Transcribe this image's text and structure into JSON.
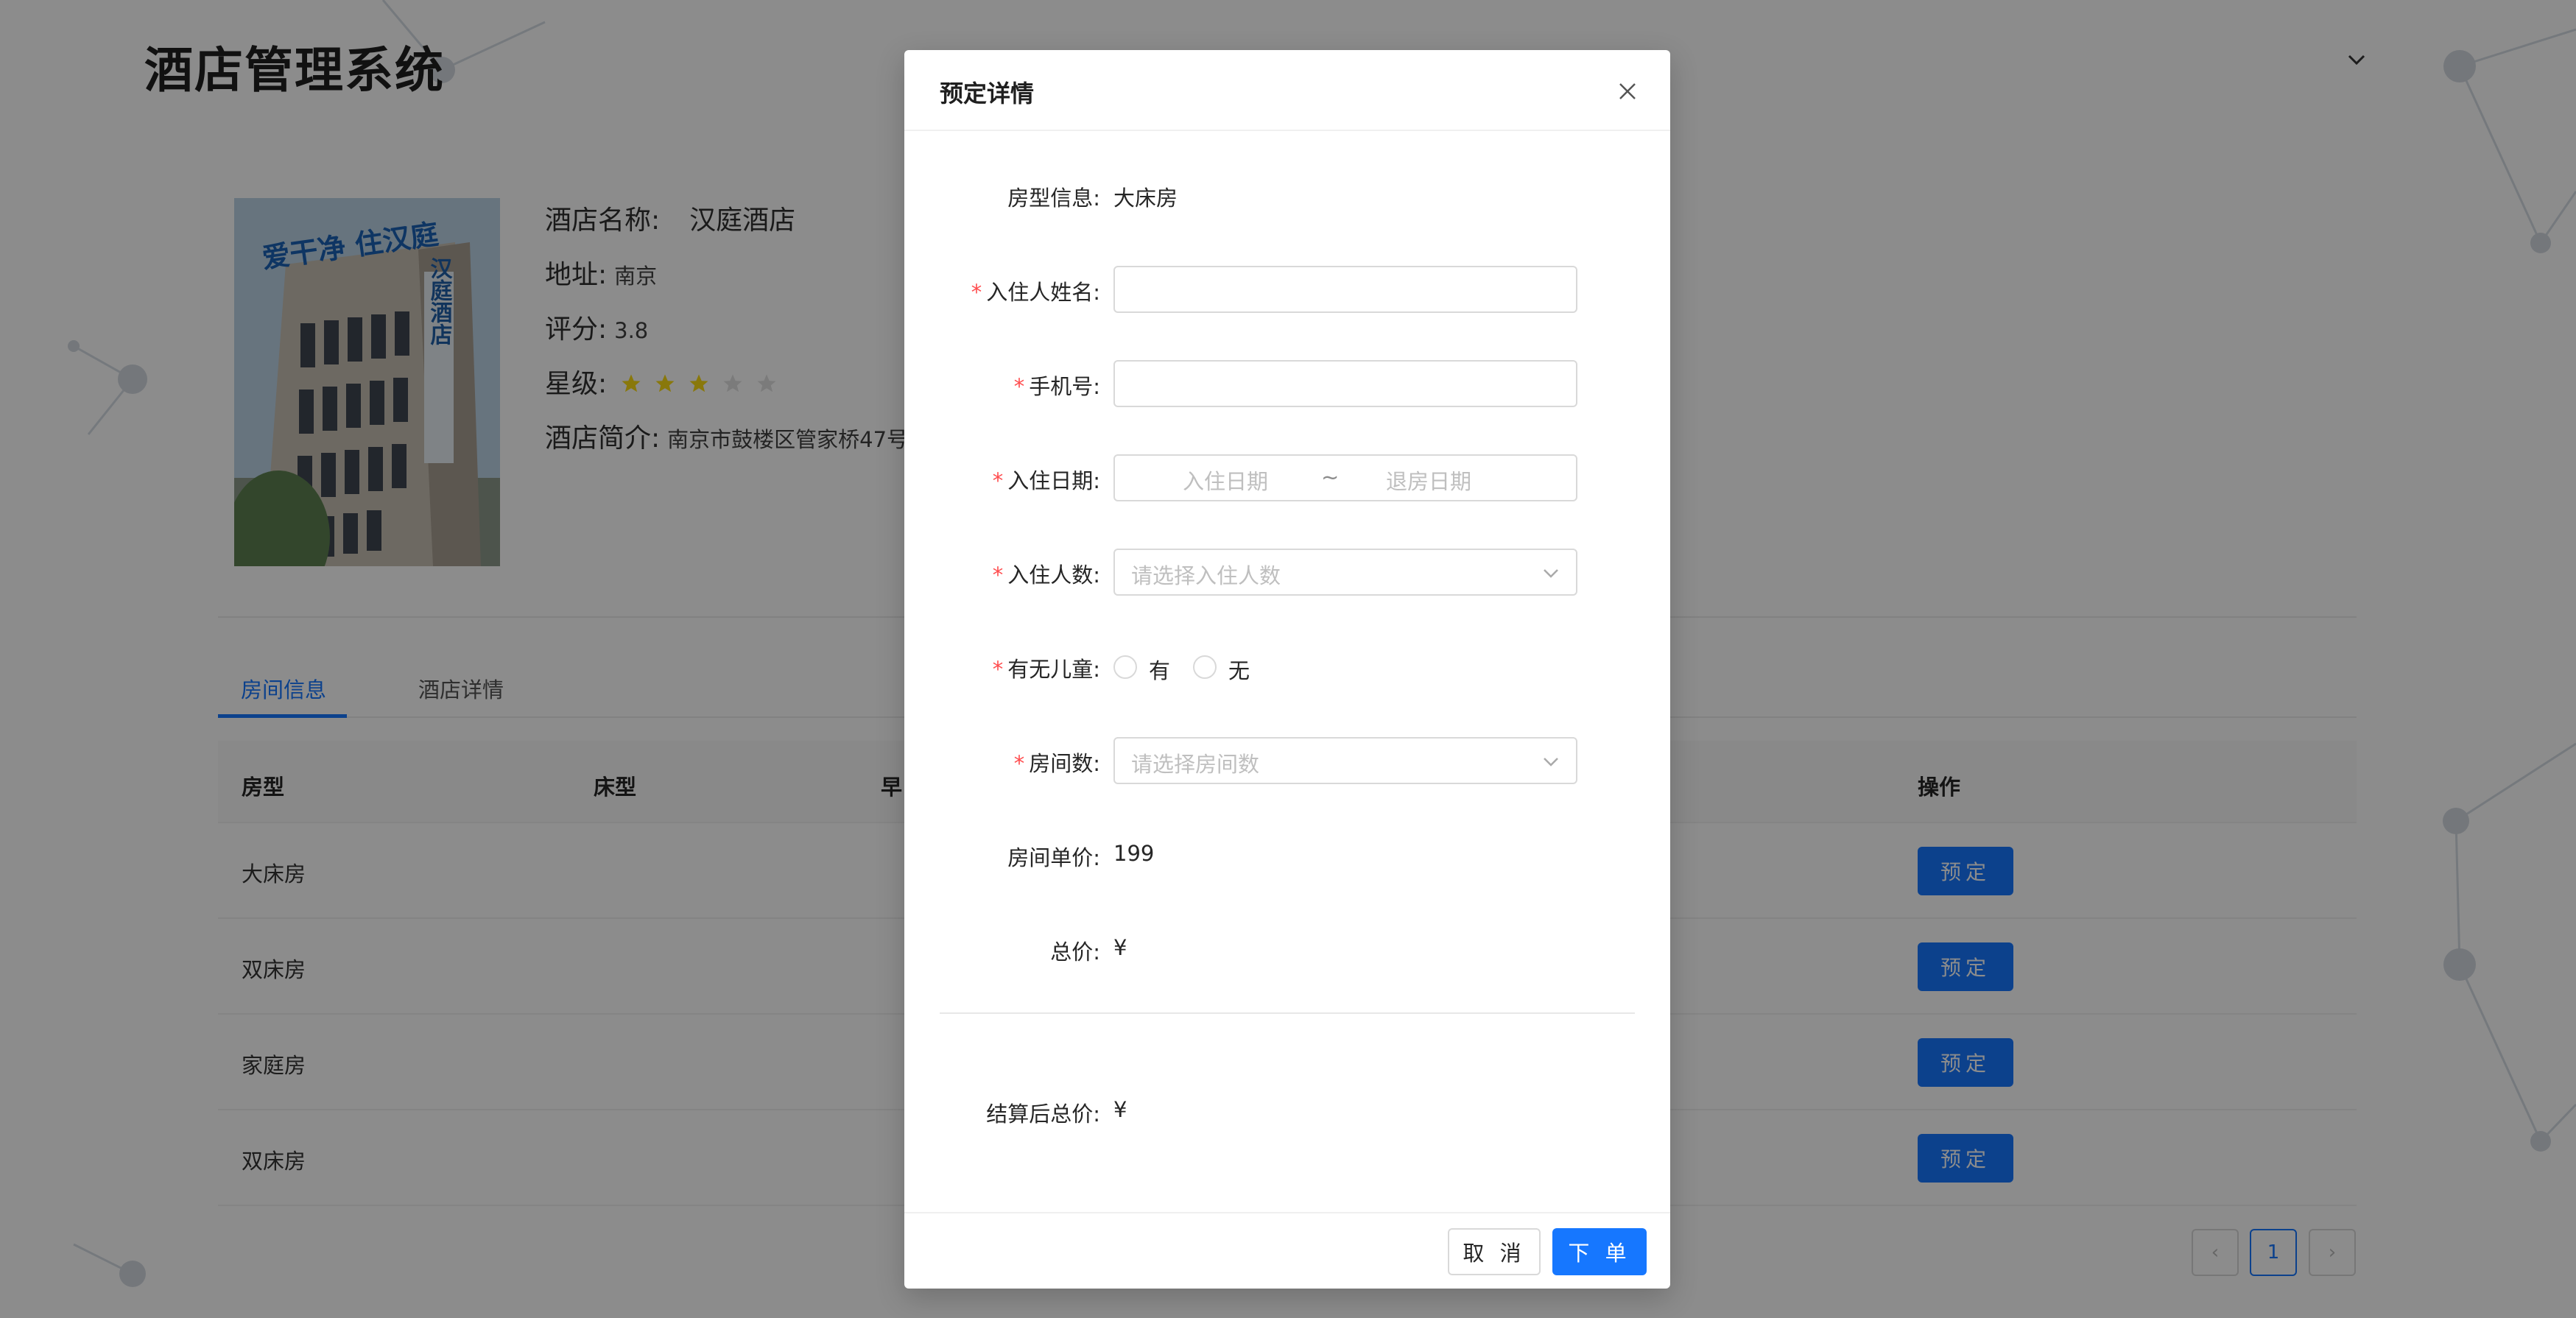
{
  "app": {
    "title": "酒店管理系统"
  },
  "hotel": {
    "name_label": "酒店名称:",
    "name": "汉庭酒店",
    "address_label": "地址:",
    "address": "南京",
    "rating_label": "评分:",
    "rating": "3.8",
    "stars_label": "星级:",
    "stars": 3,
    "stars_max": 5,
    "intro_label": "酒店简介:",
    "intro": "南京市鼓楼区管家桥47号",
    "photo_sign_top": "爱干净 住汉庭",
    "photo_sign_side": "汉庭酒店"
  },
  "tabs": [
    {
      "label": "房间信息",
      "active": true
    },
    {
      "label": "酒店详情",
      "active": false
    }
  ],
  "table": {
    "headers": [
      "房型",
      "床型",
      "早",
      "操作"
    ],
    "rows": [
      {
        "type": "大床房",
        "action": "预定"
      },
      {
        "type": "双床房",
        "action": "预定"
      },
      {
        "type": "家庭房",
        "action": "预定"
      },
      {
        "type": "双床房",
        "action": "预定"
      }
    ]
  },
  "pagination": {
    "prev": "‹",
    "current": "1",
    "next": "›"
  },
  "modal": {
    "title": "预定详情",
    "fields": {
      "room_type": {
        "label": "房型信息:",
        "value": "大床房"
      },
      "guest_name": {
        "label": "入住人姓名:",
        "required": true,
        "value": ""
      },
      "phone": {
        "label": "手机号:",
        "required": true,
        "value": ""
      },
      "dates": {
        "label": "入住日期:",
        "required": true,
        "start_placeholder": "入住日期",
        "separator": "~",
        "end_placeholder": "退房日期"
      },
      "guests": {
        "label": "入住人数:",
        "required": true,
        "placeholder": "请选择入住人数"
      },
      "children": {
        "label": "有无儿童:",
        "required": true,
        "options": [
          "有",
          "无"
        ]
      },
      "rooms": {
        "label": "房间数:",
        "required": true,
        "placeholder": "请选择房间数"
      },
      "unit_price": {
        "label": "房间单价:",
        "value": "199"
      },
      "total": {
        "label": "总价:",
        "value": "¥"
      },
      "final_total": {
        "label": "结算后总价:",
        "value": "¥"
      }
    },
    "cancel_label": "取 消",
    "submit_label": "下 单"
  },
  "colors": {
    "primary": "#1677ff",
    "required": "#ff4d4f",
    "star": "#fadb14",
    "star_empty": "#e0e0e0",
    "mask": "rgba(0,0,0,0.45)"
  }
}
